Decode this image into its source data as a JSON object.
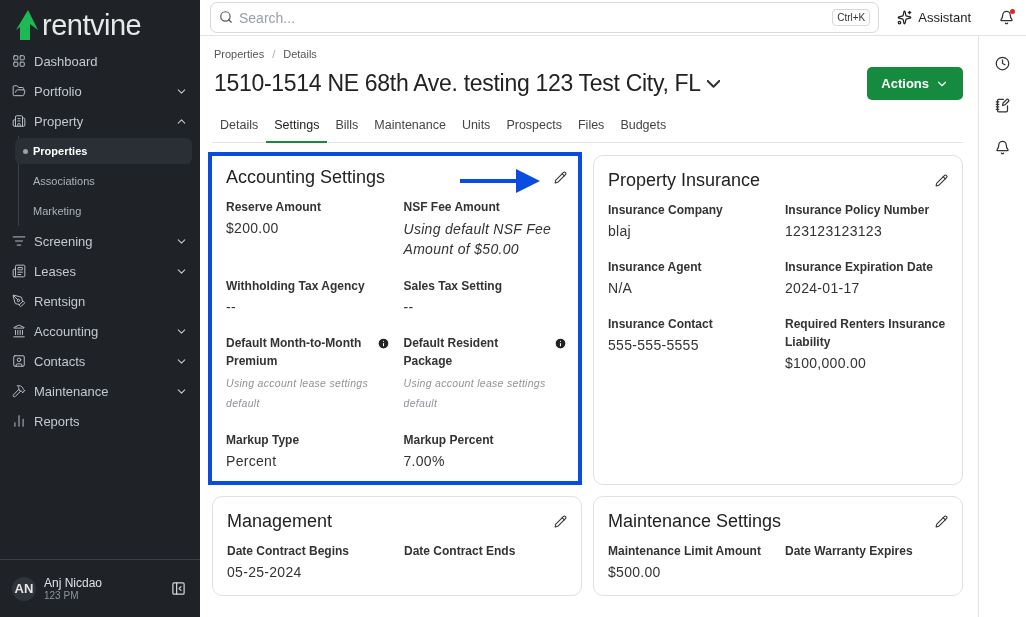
{
  "sidebar": {
    "logo": "rentvine",
    "items": [
      {
        "label": "Dashboard"
      },
      {
        "label": "Portfolio",
        "expanded": false
      },
      {
        "label": "Property",
        "expanded": true,
        "children": [
          {
            "label": "Properties",
            "selected": true
          },
          {
            "label": "Associations",
            "selected": false
          },
          {
            "label": "Marketing",
            "selected": false
          }
        ]
      },
      {
        "label": "Screening",
        "expanded": false
      },
      {
        "label": "Leases",
        "expanded": false
      },
      {
        "label": "Rentsign"
      },
      {
        "label": "Accounting",
        "expanded": false
      },
      {
        "label": "Contacts",
        "expanded": false
      },
      {
        "label": "Maintenance",
        "expanded": false
      },
      {
        "label": "Reports"
      }
    ],
    "user": {
      "initials": "AN",
      "name": "Anj Nicdao",
      "subtitle": "123 PM"
    }
  },
  "topbar": {
    "search": {
      "placeholder": "Search...",
      "shortcut": "Ctrl+K"
    },
    "assistant": "Assistant",
    "notifications_unread": true
  },
  "breadcrumb": {
    "items": [
      "Properties",
      "Details"
    ],
    "separator": "/"
  },
  "title": "1510-1514 NE 68th Ave. testing 123 Test City, FL",
  "actions": "Actions",
  "tabs": [
    {
      "label": "Details",
      "selected": false
    },
    {
      "label": "Settings",
      "selected": true
    },
    {
      "label": "Bills",
      "selected": false
    },
    {
      "label": "Maintenance",
      "selected": false
    },
    {
      "label": "Units",
      "selected": false
    },
    {
      "label": "Prospects",
      "selected": false
    },
    {
      "label": "Files",
      "selected": false
    },
    {
      "label": "Budgets",
      "selected": false
    }
  ],
  "cards": [
    {
      "title": "Accounting Settings",
      "highlighted": true,
      "arrow": true,
      "fields": [
        {
          "label": "Reserve Amount",
          "value": "$200.00",
          "kind": "plain"
        },
        {
          "label": "NSF Fee Amount",
          "value": "Using default NSF Fee Amount of $50.00",
          "kind": "italic"
        },
        {
          "label": "Withholding Tax Agency",
          "value": "--",
          "kind": "plain"
        },
        {
          "label": "Sales Tax Setting",
          "value": "--",
          "kind": "plain"
        },
        {
          "label": "Default Month-to-Month Premium",
          "value": "Using account lease settings default",
          "kind": "hint",
          "info": true
        },
        {
          "label": "Default Resident Package",
          "value": "Using account lease settings default",
          "kind": "hint",
          "info": true
        },
        {
          "label": "Markup Type",
          "value": "Percent",
          "kind": "plain"
        },
        {
          "label": "Markup Percent",
          "value": "7.00%",
          "kind": "plain"
        }
      ]
    },
    {
      "title": "Property Insurance",
      "highlighted": false,
      "fields": [
        {
          "label": "Insurance Company",
          "value": "blaj",
          "kind": "plain"
        },
        {
          "label": "Insurance Policy Number",
          "value": "123123123123",
          "kind": "plain"
        },
        {
          "label": "Insurance Agent",
          "value": "N/A",
          "kind": "plain"
        },
        {
          "label": "Insurance Expiration Date",
          "value": "2024-01-17",
          "kind": "plain"
        },
        {
          "label": "Insurance Contact",
          "value": "555-555-5555",
          "kind": "plain"
        },
        {
          "label": "Required Renters Insurance Liability",
          "value": "$100,000.00",
          "kind": "plain"
        }
      ]
    },
    {
      "title": "Management",
      "highlighted": false,
      "fields": [
        {
          "label": "Date Contract Begins",
          "value": "05-25-2024",
          "kind": "plain"
        },
        {
          "label": "Date Contract Ends"
        }
      ]
    },
    {
      "title": "Maintenance Settings",
      "highlighted": false,
      "fields": [
        {
          "label": "Maintenance Limit Amount",
          "value": "$500.00",
          "kind": "plain"
        },
        {
          "label": "Date Warranty Expires"
        }
      ]
    }
  ]
}
